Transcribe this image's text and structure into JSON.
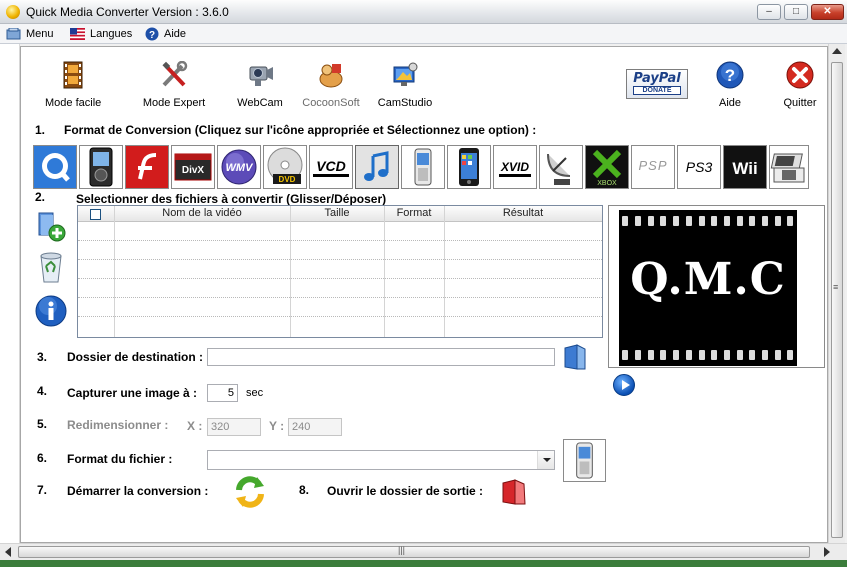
{
  "window": {
    "title": "Quick Media Converter   Version : 3.6.0",
    "min_symbol": "–",
    "max_symbol": "□",
    "close_symbol": "✕"
  },
  "menubar": {
    "menu": "Menu",
    "languages": "Langues",
    "help": "Aide"
  },
  "toolbar": {
    "easy_mode": "Mode facile",
    "expert_mode": "Mode Expert",
    "webcam": "WebCam",
    "cocoonsoft": "CocoonSoft",
    "camstudio": "CamStudio",
    "paypal_top": "PayPal",
    "paypal_bottom": "DONATE",
    "help": "Aide",
    "quit": "Quitter"
  },
  "steps": {
    "s1_num": "1.",
    "s1_label": "Format de Conversion (Cliquez sur l'icône appropriée et Sélectionnez une option) :",
    "s2_num": "2.",
    "s2_label": "Selectionner des fichiers à convertir (Glisser/Déposer)",
    "s3_num": "3.",
    "s3_label": "Dossier de destination :",
    "s4_num": "4.",
    "s4_label": "Capturer une image à :",
    "s4_unit": "sec",
    "s5_num": "5.",
    "s5_label": "Redimensionner :",
    "s6_num": "6.",
    "s6_label": "Format du fichier :",
    "s7_num": "7.",
    "s7_label": "Démarrer  la conversion :",
    "s8_num": "8.",
    "s8_label": "Ouvrir  le dossier de sortie :"
  },
  "formats": {
    "divx": "DivX",
    "wmv": "WMV",
    "dvd": "DVD",
    "vcd": "VCD",
    "xvid": "XVID",
    "xbox": "XBOX",
    "psp": "PSP",
    "ps3": "PS3",
    "wii": "Wii"
  },
  "grid": {
    "columns": [
      "Nom de la vidéo",
      "Taille",
      "Format",
      "Résultat"
    ],
    "rows": []
  },
  "preview": {
    "text": "Q.M.C"
  },
  "fields": {
    "destination_value": "",
    "capture_seconds": "5",
    "x_label": "X :",
    "y_label": "Y :",
    "width": "320",
    "height": "240",
    "file_format_value": ""
  },
  "scrollbar": {
    "grip": "|||",
    "vgrip": "≡"
  }
}
